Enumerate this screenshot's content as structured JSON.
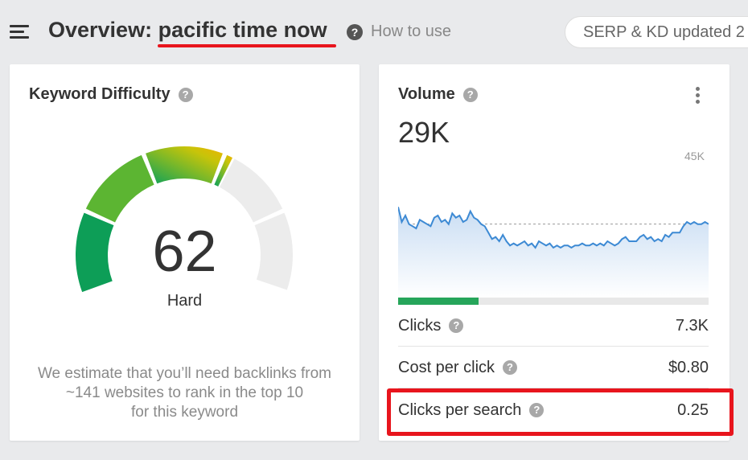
{
  "header": {
    "title_prefix": "Overview: ",
    "keyword": "pacific time now",
    "how_to_use": "How to use",
    "serp_pill": "SERP & KD updated 2",
    "question_glyph": "?"
  },
  "keyword_difficulty": {
    "title": "Keyword Difficulty",
    "value": "62",
    "level": "Hard",
    "description_lines": [
      "We estimate that you’ll need backlinks from",
      "~141 websites to rank in the top 10",
      "for this keyword"
    ],
    "gauge_fraction": 0.62
  },
  "volume": {
    "title": "Volume",
    "value": "29K",
    "y_max_label": "45K",
    "clicks_fraction": 0.26,
    "chart_data": {
      "type": "area",
      "ylim": [
        0,
        45000
      ],
      "values": [
        34000,
        27000,
        30000,
        26000,
        25000,
        24000,
        28000,
        27000,
        26000,
        25000,
        29000,
        30000,
        27000,
        28000,
        26000,
        31000,
        29000,
        30000,
        27000,
        28000,
        32000,
        29000,
        28000,
        26000,
        25000,
        22000,
        19000,
        20000,
        18000,
        21000,
        18000,
        16000,
        17000,
        16000,
        17000,
        18000,
        16000,
        17000,
        15000,
        18000,
        17000,
        16000,
        17000,
        15000,
        16000,
        15000,
        16000,
        16000,
        15000,
        16000,
        16000,
        17000,
        16000,
        16000,
        17000,
        16000,
        17000,
        16000,
        18000,
        17000,
        16000,
        17000,
        19000,
        20000,
        18000,
        18000,
        18000,
        20000,
        21000,
        19000,
        20000,
        18000,
        19000,
        18000,
        21000,
        20000,
        22000,
        22000,
        22000,
        25000,
        27000,
        26000,
        27000,
        26000,
        26000,
        27000,
        26000
      ]
    }
  },
  "metrics": [
    {
      "label": "Clicks",
      "value": "7.3K"
    },
    {
      "label": "Cost per click",
      "value": "$0.80"
    },
    {
      "label": "Clicks per search",
      "value": "0.25"
    }
  ],
  "colors": {
    "accent_red": "#e8151d",
    "green": "#26a55a",
    "line_blue": "#3d8ad4"
  }
}
